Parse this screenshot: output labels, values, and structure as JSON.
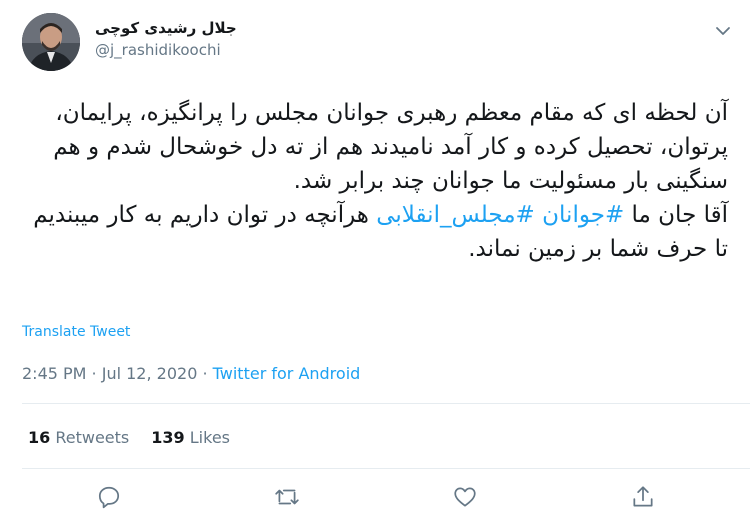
{
  "author": {
    "display_name": "جلال رشیدی کوچی",
    "handle": "@j_rashidikoochi"
  },
  "tweet": {
    "text_before_tags": "آن لحظه ای که مقام معظم رهبری جوانان مجلس را پرانگیزه، پرایمان، پرتوان، تحصیل کرده و کار آمد نامیدند هم از ته دل خوشحال شدم و هم سنگینی بار مسئولیت ما جوانان چند برابر شد.\nآقا جان ما ",
    "hashtag_1": "#جوانان",
    "space": " ",
    "hashtag_2": "#مجلس_انقلابی",
    "text_after_tags": " هرآنچه در توان داریم به کار میبندیم تا حرف شما بر زمین نماند."
  },
  "translate_label": "Translate Tweet",
  "meta": {
    "time": "2:45 PM",
    "dot1": " · ",
    "date": "Jul 12, 2020",
    "dot2": " · ",
    "source": "Twitter for Android"
  },
  "stats": {
    "retweets_count": "16",
    "retweets_label": "Retweets",
    "likes_count": "139",
    "likes_label": "Likes"
  },
  "icons": {
    "reply": "reply-icon",
    "retweet": "retweet-icon",
    "like": "heart-icon",
    "share": "share-icon",
    "menu": "chevron-down-icon"
  },
  "colors": {
    "accent": "#1da1f2",
    "secondary_text": "#657786",
    "divider": "#e6ecf0"
  }
}
